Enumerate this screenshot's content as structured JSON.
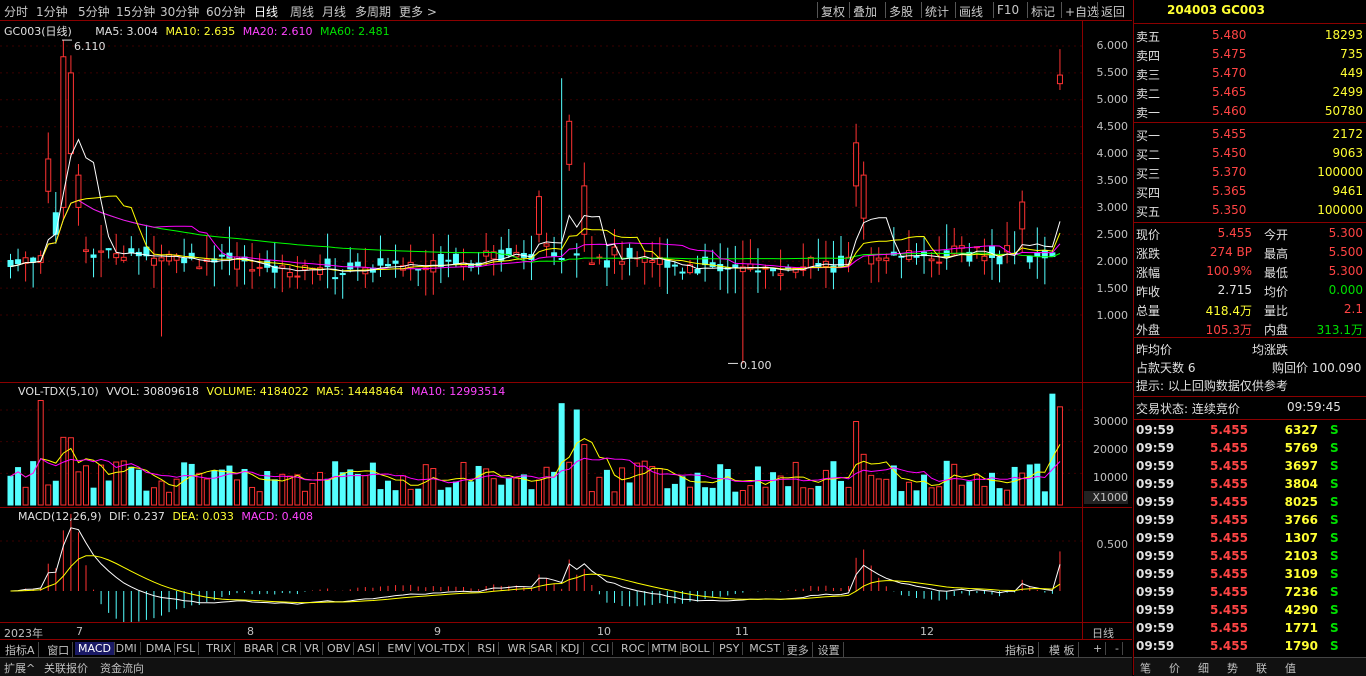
{
  "toolbar": {
    "periods": [
      "分时",
      "1分钟",
      "5分钟",
      "15分钟",
      "30分钟",
      "60分钟",
      "日线",
      "周线",
      "月线",
      "多周期",
      "更多 >"
    ],
    "active_period": "日线",
    "buttons": [
      "复权",
      "叠加",
      "多股",
      "统计",
      "画线",
      "F10",
      "标记",
      "+自选",
      "返回"
    ]
  },
  "main_header": {
    "symbol": "GC003(日线)",
    "ma5": "MA5: 3.004",
    "ma10": "MA10: 2.635",
    "ma20": "MA20: 2.610",
    "ma60": "MA60: 2.481"
  },
  "annotations": {
    "high": "6.110",
    "low": "0.100"
  },
  "y_ticks": [
    "6.000",
    "5.500",
    "5.000",
    "4.500",
    "4.000",
    "3.500",
    "3.000",
    "2.500",
    "2.000",
    "1.500",
    "1.000"
  ],
  "vol_header": {
    "name": "VOL-TDX(5,10)",
    "vvol": "VVOL: 30809618",
    "volume": "VOLUME: 4184022",
    "ma5": "MA5: 14448464",
    "ma10": "MA10: 12993514"
  },
  "vol_ticks": [
    "30000",
    "20000",
    "10000"
  ],
  "vol_unit": "X1000",
  "macd_header": {
    "name": "MACD(12,26,9)",
    "dif": "DIF: 0.237",
    "dea": "DEA: 0.033",
    "macd": "MACD: 0.408"
  },
  "macd_ticks": [
    "0.500"
  ],
  "x_labels": [
    "2023年",
    "7",
    "8",
    "9",
    "10",
    "11",
    "12"
  ],
  "x_right": "日线",
  "indicator_tabs": [
    "指标A",
    "窗口",
    "MACD",
    "DMI",
    "DMA",
    "FSL",
    "TRIX",
    "BRAR",
    "CR",
    "VR",
    "OBV",
    "ASI",
    "EMV",
    "VOL-TDX",
    "RSI",
    "WR",
    "SAR",
    "KDJ",
    "CCI",
    "ROC",
    "MTM",
    "BOLL",
    "PSY",
    "MCST",
    "更多",
    "设置"
  ],
  "indicator_selected": "MACD",
  "indicator_right": [
    "指标B",
    "模 板",
    "+",
    "-"
  ],
  "bottom_tabs": [
    "扩展^",
    "关联报价",
    "资金流向"
  ],
  "quote": {
    "title": "204003 GC003",
    "asks": [
      {
        "label": "卖五",
        "price": "5.480",
        "vol": "18293"
      },
      {
        "label": "卖四",
        "price": "5.475",
        "vol": "735"
      },
      {
        "label": "卖三",
        "price": "5.470",
        "vol": "449"
      },
      {
        "label": "卖二",
        "price": "5.465",
        "vol": "2499"
      },
      {
        "label": "卖一",
        "price": "5.460",
        "vol": "50780"
      }
    ],
    "bids": [
      {
        "label": "买一",
        "price": "5.455",
        "vol": "2172"
      },
      {
        "label": "买二",
        "price": "5.450",
        "vol": "9063"
      },
      {
        "label": "买三",
        "price": "5.370",
        "vol": "100000"
      },
      {
        "label": "买四",
        "price": "5.365",
        "vol": "9461"
      },
      {
        "label": "买五",
        "price": "5.350",
        "vol": "100000"
      }
    ],
    "stats": [
      {
        "l1": "现价",
        "v1": "5.455",
        "l2": "今开",
        "v2": "5.300"
      },
      {
        "l1": "涨跌",
        "v1": "274 BP",
        "l2": "最高",
        "v2": "5.500"
      },
      {
        "l1": "涨幅",
        "v1": "100.9%",
        "l2": "最低",
        "v2": "5.300"
      },
      {
        "l1": "昨收",
        "v1": "2.715",
        "l2": "均价",
        "v2": "0.000"
      },
      {
        "l1": "总量",
        "v1": "418.4万",
        "l2": "量比",
        "v2": "2.1"
      },
      {
        "l1": "外盘",
        "v1": "105.3万",
        "l2": "内盘",
        "v2": "313.1万"
      }
    ],
    "extra1_l": "昨均价",
    "extra1_r": "均涨跌",
    "extra2_l": "占款天数 6",
    "extra2_r": "购回价 100.090",
    "hint": "提示: 以上回购数据仅供参考",
    "status_label": "交易状态: 连续竞价",
    "status_time": "09:59:45",
    "ticks": [
      {
        "t": "09:59",
        "p": "5.455",
        "v": "6327",
        "s": "S"
      },
      {
        "t": "09:59",
        "p": "5.455",
        "v": "5769",
        "s": "S"
      },
      {
        "t": "09:59",
        "p": "5.455",
        "v": "3697",
        "s": "S"
      },
      {
        "t": "09:59",
        "p": "5.455",
        "v": "3804",
        "s": "S"
      },
      {
        "t": "09:59",
        "p": "5.455",
        "v": "8025",
        "s": "S"
      },
      {
        "t": "09:59",
        "p": "5.455",
        "v": "3766",
        "s": "S"
      },
      {
        "t": "09:59",
        "p": "5.455",
        "v": "1307",
        "s": "S"
      },
      {
        "t": "09:59",
        "p": "5.455",
        "v": "2103",
        "s": "S"
      },
      {
        "t": "09:59",
        "p": "5.455",
        "v": "3109",
        "s": "S"
      },
      {
        "t": "09:59",
        "p": "5.455",
        "v": "7236",
        "s": "S"
      },
      {
        "t": "09:59",
        "p": "5.455",
        "v": "4290",
        "s": "S"
      },
      {
        "t": "09:59",
        "p": "5.455",
        "v": "1771",
        "s": "S"
      },
      {
        "t": "09:59",
        "p": "5.455",
        "v": "1790",
        "s": "S"
      }
    ],
    "tabs": [
      "笔",
      "价",
      "细",
      "势",
      "联",
      "值"
    ]
  },
  "chart_data": {
    "type": "candlestick",
    "colors": {
      "up": "#ff3232",
      "down": "#54ffff",
      "ma5": "#ffffff",
      "ma10": "#ffff00",
      "ma20": "#ff00ff",
      "ma60": "#00ff00"
    },
    "price_ylim": [
      0.1,
      6.2
    ],
    "vol_ylim": [
      0,
      36000
    ],
    "macd_ylim": [
      -0.4,
      1.0
    ],
    "seed": 7
  }
}
